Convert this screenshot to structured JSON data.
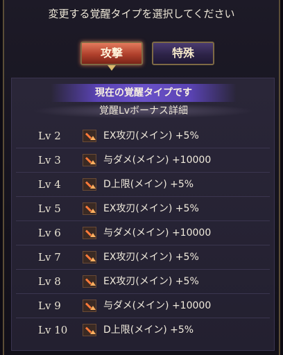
{
  "title": "変更する覚醒タイプを選択してください",
  "tabs": [
    {
      "label": "攻撃",
      "selected": true
    },
    {
      "label": "特殊",
      "selected": false
    }
  ],
  "panel": {
    "current_label": "現在の覚醒タイプです",
    "bonus_header": "覚醒Lvボーナス詳細",
    "bonuses": [
      {
        "level": "Lv 2",
        "icon": "attack-up-icon",
        "effect": "EX攻刃(メイン) +5%"
      },
      {
        "level": "Lv 3",
        "icon": "attack-up-icon",
        "effect": "与ダメ(メイン) +10000"
      },
      {
        "level": "Lv 4",
        "icon": "attack-up-icon",
        "effect": "D上限(メイン) +5%"
      },
      {
        "level": "Lv 5",
        "icon": "attack-up-icon",
        "effect": "EX攻刃(メイン) +5%"
      },
      {
        "level": "Lv 6",
        "icon": "attack-up-icon",
        "effect": "与ダメ(メイン) +10000"
      },
      {
        "level": "Lv 7",
        "icon": "attack-up-icon",
        "effect": "EX攻刃(メイン) +5%"
      },
      {
        "level": "Lv 8",
        "icon": "attack-up-icon",
        "effect": "EX攻刃(メイン) +5%"
      },
      {
        "level": "Lv 9",
        "icon": "attack-up-icon",
        "effect": "与ダメ(メイン) +10000"
      },
      {
        "level": "Lv 10",
        "icon": "attack-up-icon",
        "effect": "D上限(メイン) +5%"
      }
    ]
  }
}
